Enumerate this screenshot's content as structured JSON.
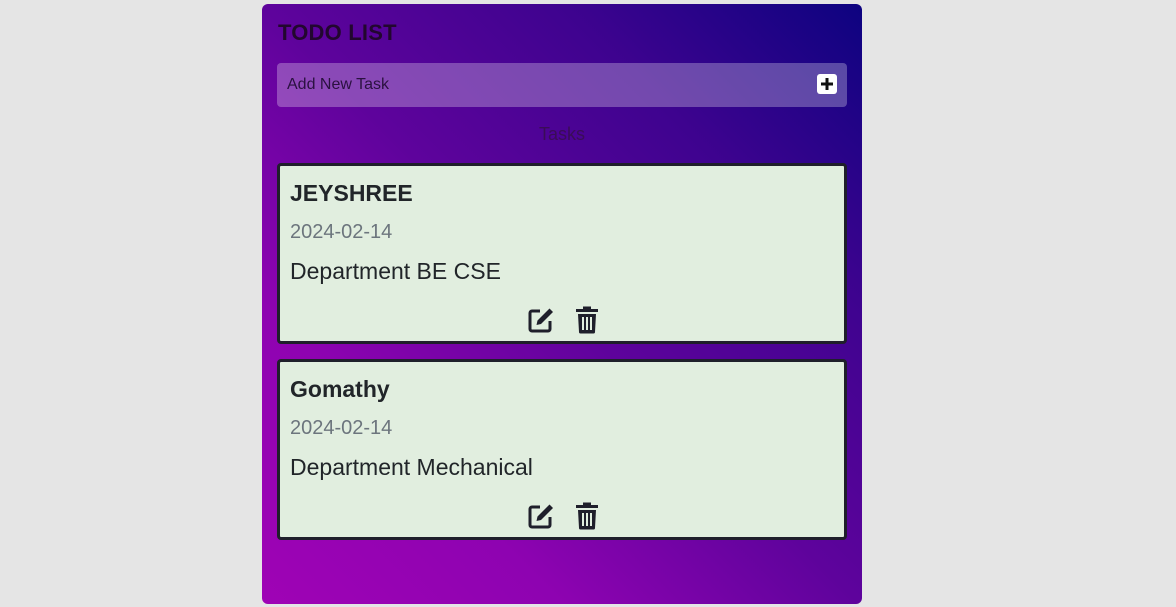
{
  "app": {
    "title": "TODO LIST"
  },
  "add_task": {
    "placeholder": "Add New Task",
    "button_icon": "plus-icon"
  },
  "section_label": "Tasks",
  "tasks": [
    {
      "name": "JEYSHREE",
      "date": "2024-02-14",
      "description": "Department BE CSE",
      "actions": [
        "edit-icon",
        "trash-icon"
      ]
    },
    {
      "name": "Gomathy",
      "date": "2024-02-14",
      "description": "Department Mechanical",
      "actions": [
        "edit-icon",
        "trash-icon"
      ]
    }
  ],
  "colors": {
    "page_background": "#e5e5e5",
    "gradient_start": "#0d0380",
    "gradient_end": "#9f03b5",
    "card_background": "#e1eedf",
    "card_border": "#1f1f2b",
    "date_text": "#6c757d"
  }
}
